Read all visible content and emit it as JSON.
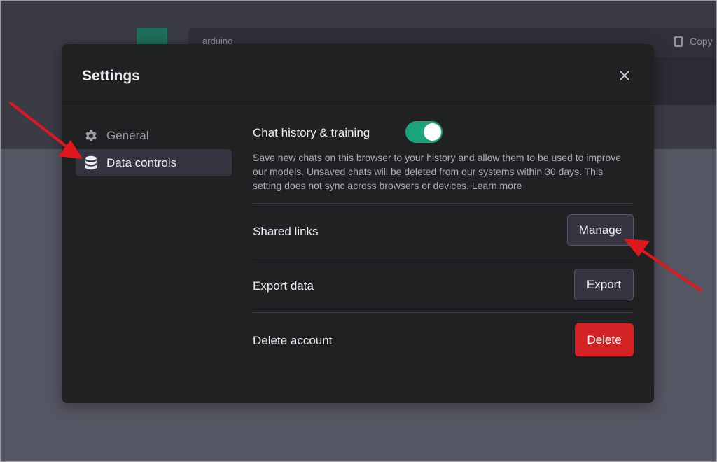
{
  "background": {
    "code_language": "arduino",
    "copy_label": "Copy",
    "avatar_icon": "openai-logo-icon",
    "copy_icon": "clipboard-icon"
  },
  "modal": {
    "title": "Settings",
    "close_icon": "close-icon"
  },
  "sidebar": {
    "items": [
      {
        "label": "General",
        "icon": "gear-icon",
        "selected": false
      },
      {
        "label": "Data controls",
        "icon": "database-icon",
        "selected": true
      }
    ]
  },
  "settings": {
    "chat_history": {
      "title": "Chat history & training",
      "description": "Save new chats on this browser to your history and allow them to be used to improve our models. Unsaved chats will be deleted from our systems within 30 days. This setting does not sync across browsers or devices.",
      "learn_more": "Learn more",
      "enabled": true
    },
    "shared_links": {
      "title": "Shared links",
      "button": "Manage"
    },
    "export_data": {
      "title": "Export data",
      "button": "Export"
    },
    "delete_account": {
      "title": "Delete account",
      "button": "Delete"
    }
  },
  "colors": {
    "accent": "#19a47a",
    "danger": "#d32226",
    "annotation_arrow": "#e0181e",
    "modal_bg": "#202123",
    "selected_bg": "#343541"
  }
}
